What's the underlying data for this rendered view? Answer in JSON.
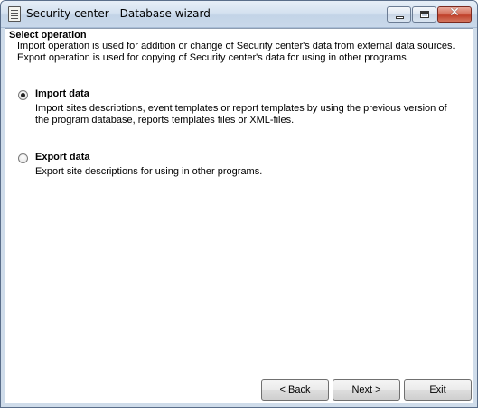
{
  "window": {
    "title": "Security center - Database wizard"
  },
  "header": {
    "title": "Select operation",
    "description": "Import operation is used for addition or change of Security center's data from external data sources. Export operation is used for copying of Security center's data for using in other programs."
  },
  "options": [
    {
      "label": "Import data",
      "description": "Import sites descriptions, event templates or report templates by using the previous version of the program database, reports templates files or XML-files.",
      "selected": true
    },
    {
      "label": "Export data",
      "description": "Export site descriptions for using in other programs.",
      "selected": false
    }
  ],
  "buttons": {
    "back": "< Back",
    "next": "Next >",
    "exit": "Exit"
  }
}
